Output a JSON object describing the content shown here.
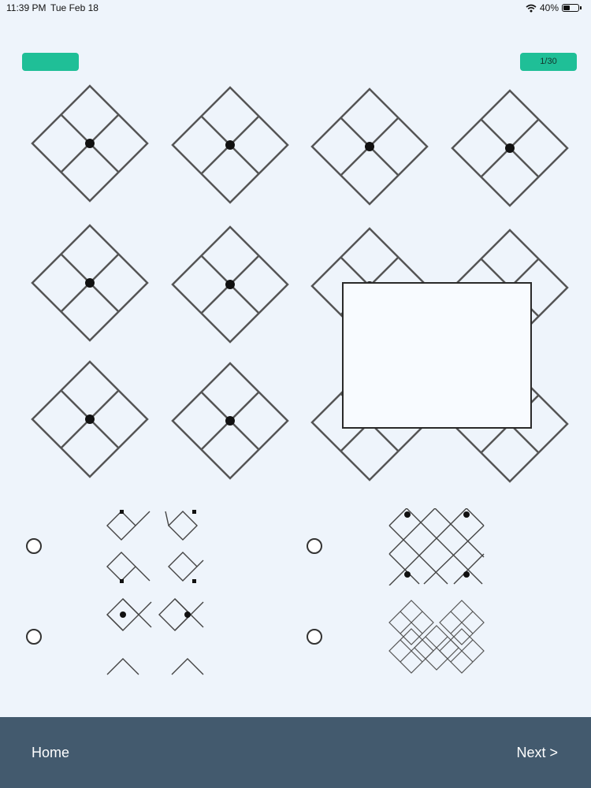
{
  "status": {
    "time": "11:39 PM",
    "date": "Tue Feb 18",
    "battery": "40%",
    "icons": [
      "wifi-icon",
      "battery-icon"
    ]
  },
  "header": {
    "counter": "1/30",
    "accent_color": "#1fbf97"
  },
  "puzzle": {
    "rows": 3,
    "cols": 4,
    "missing_region": "bottom-right 2x2"
  },
  "options": [
    {
      "id": "option-1",
      "pattern": "corner-squares-with-dots"
    },
    {
      "id": "option-2",
      "pattern": "grid-with-corner-dots"
    },
    {
      "id": "option-3",
      "pattern": "diamonds-with-center-dots"
    },
    {
      "id": "option-4",
      "pattern": "dense-diamond-lattice"
    }
  ],
  "nav": {
    "home_label": "Home",
    "next_label": "Next >",
    "bar_color": "#435a6e"
  }
}
